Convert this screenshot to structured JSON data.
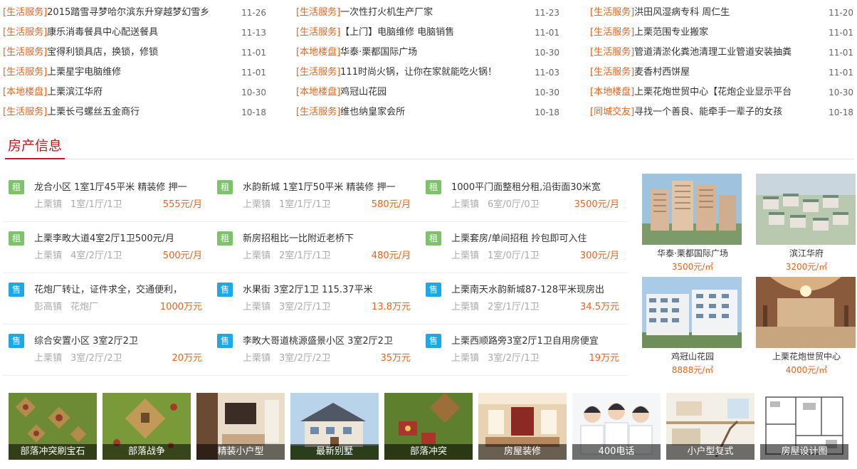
{
  "news": {
    "columns": [
      [
        {
          "tag": "[生活服务]",
          "title": "2015踏雪寻梦哈尔滨东升穿越梦幻雪乡",
          "date": "11-26"
        },
        {
          "tag": "[生活服务]",
          "title": "康乐消毒餐具中心配送餐具",
          "date": "11-13"
        },
        {
          "tag": "[生活服务]",
          "title": "宝得利锁具店，换锁，修锁",
          "date": "11-01"
        },
        {
          "tag": "[生活服务]",
          "title": "上栗星宇电脑维修",
          "date": "11-01"
        },
        {
          "tag": "[本地楼盘]",
          "title": "上栗滨江华府",
          "date": "10-30"
        },
        {
          "tag": "[生活服务]",
          "title": "上栗长弓螺丝五金商行",
          "date": "10-18"
        }
      ],
      [
        {
          "tag": "[生活服务]",
          "title": "一次性打火机生产厂家",
          "date": "11-23"
        },
        {
          "tag": "[生活服务]",
          "title": "【上门】电脑维修 电脑销售",
          "date": "11-01"
        },
        {
          "tag": "[本地楼盘]",
          "title": "华泰·栗都国际广场",
          "date": "10-30"
        },
        {
          "tag": "[生活服务]",
          "title": "111时尚火锅，让你在家就能吃火锅！",
          "date": "11-03"
        },
        {
          "tag": "[本地楼盘]",
          "title": "鸡冠山花园",
          "date": "10-30"
        },
        {
          "tag": "[生活服务]",
          "title": "维也纳皇家会所",
          "date": "10-18"
        }
      ],
      [
        {
          "tag": "[生活服务]",
          "title": "洪田风湿病专科 周仁生",
          "date": "11-20"
        },
        {
          "tag": "[生活服务]",
          "title": "上栗范围专业搬家",
          "date": "11-01"
        },
        {
          "tag": "[生活服务]",
          "title": "管道清淤化粪池清理工业管道安装抽粪",
          "date": "11-01"
        },
        {
          "tag": "[生活服务]",
          "title": "麦香村西饼屋",
          "date": "11-01"
        },
        {
          "tag": "[本地楼盘]",
          "title": "上栗花炮世贸中心【花炮企业显示平台",
          "date": "10-30"
        },
        {
          "tag": "[同城交友]",
          "title": "寻找一个善良、能牵手一辈子的女孩",
          "date": "10-18"
        }
      ]
    ]
  },
  "section": {
    "title": "房产信息"
  },
  "listings": [
    [
      {
        "badge": "租",
        "kind": "rent",
        "title": "龙合小区 1室1厅45平米 精装修 押一",
        "area": "上栗镇",
        "layout": "1室/1厅/1卫",
        "price": "555元/月"
      },
      {
        "badge": "租",
        "kind": "rent",
        "title": "水韵新城 1室1厅50平米 精装修 押一",
        "area": "上栗镇",
        "layout": "1室/1厅/1卫",
        "price": "580元/月"
      },
      {
        "badge": "租",
        "kind": "rent",
        "title": "1000平门面整租分租,沿街面30米宽",
        "area": "上栗镇",
        "layout": "6室/0厅/0卫",
        "price": "3500元/月"
      }
    ],
    [
      {
        "badge": "租",
        "kind": "rent",
        "title": "上栗李畋大道4室2厅1卫500元/月",
        "area": "上栗镇",
        "layout": "4室/2厅/1卫",
        "price": "500元/月"
      },
      {
        "badge": "租",
        "kind": "rent",
        "title": "新房招租比一比附近老桥下",
        "area": "上栗镇",
        "layout": "2室/1厅/1卫",
        "price": "480元/月"
      },
      {
        "badge": "租",
        "kind": "rent",
        "title": "上栗套房/单间招租  拎包即可入住",
        "area": "上栗镇",
        "layout": "1室/0厅/1卫",
        "price": "300元/月"
      }
    ],
    [
      {
        "badge": "售",
        "kind": "sell",
        "title": "花炮厂转让，证件求全，交通便利，",
        "area": "彭高镇",
        "layout": "花炮厂",
        "price": "1000万元"
      },
      {
        "badge": "售",
        "kind": "sell",
        "title": "水果街 3室2厅1卫 115.37平米",
        "area": "上栗镇",
        "layout": "3室/2厅/1卫",
        "price": "13.8万元"
      },
      {
        "badge": "售",
        "kind": "sell",
        "title": "上栗南天水韵新城87-128平米现房出",
        "area": "上栗镇",
        "layout": "2室/1厅/1卫",
        "price": "34.5万元"
      }
    ],
    [
      {
        "badge": "售",
        "kind": "sell",
        "title": "综合安置小区 3室2厅2卫",
        "area": "上栗镇",
        "layout": "3室/2厅/2卫",
        "price": "20万元"
      },
      {
        "badge": "售",
        "kind": "sell",
        "title": "李畋大哥道桃源盛景小区 3室2厅2卫",
        "area": "上栗镇",
        "layout": "3室/2厅/2卫",
        "price": "35万元"
      },
      {
        "badge": "售",
        "kind": "sell",
        "title": "上栗西顺路旁3室2厅1卫自用房便宜",
        "area": "上栗镇",
        "layout": "3室/2厅/1卫",
        "price": "19万元"
      }
    ]
  ],
  "photos": [
    {
      "name": "华泰·栗都国际广场",
      "price": "3500元/㎡"
    },
    {
      "name": "滨江华府",
      "price": "3200元/㎡"
    },
    {
      "name": "鸡冠山花园",
      "price": "8888元/㎡"
    },
    {
      "name": "上栗花炮世贸中心",
      "price": "4000元/㎡"
    }
  ],
  "thumbs": [
    {
      "label": "部落冲突刷宝石",
      "icon": "game-map-image"
    },
    {
      "label": "部落战争",
      "icon": "game-map-image"
    },
    {
      "label": "精装小户型",
      "icon": "interior-image"
    },
    {
      "label": "最新别墅",
      "icon": "villa-image"
    },
    {
      "label": "部落冲突",
      "icon": "game-map-image"
    },
    {
      "label": "房屋装修",
      "icon": "interior-image"
    },
    {
      "label": "400电话",
      "icon": "call-center-image"
    },
    {
      "label": "小户型复式",
      "icon": "loft-image"
    },
    {
      "label": "房屋设计图",
      "icon": "floorplan-image"
    }
  ],
  "colors": {
    "accent": "#e8641b",
    "section_red": "#c9151e",
    "rent_badge": "#7cc36a",
    "sell_badge": "#1ea8e8"
  }
}
